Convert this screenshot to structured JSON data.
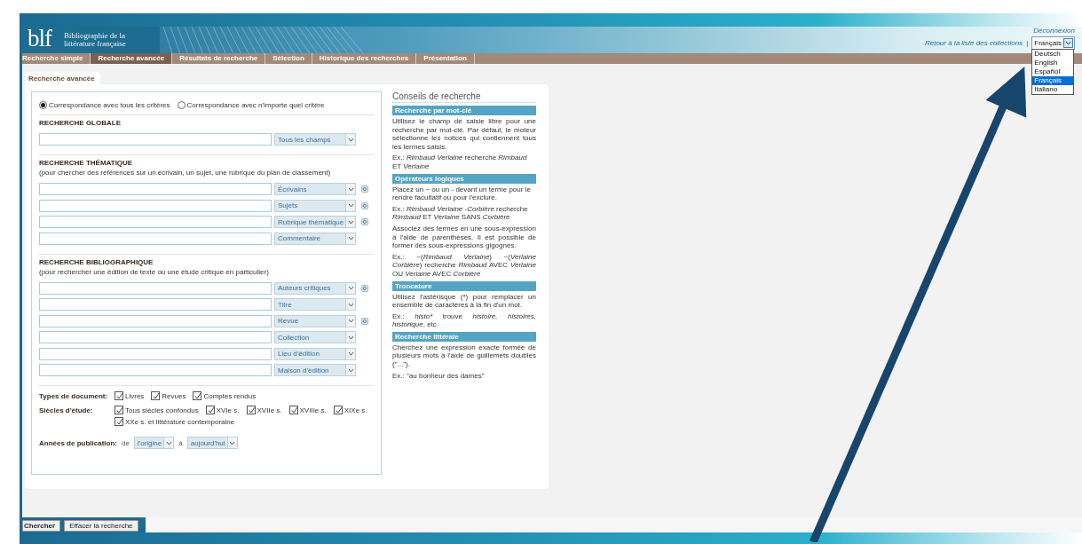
{
  "header": {
    "logo": "blf",
    "title": "Bibliographie de la littérature française"
  },
  "top_links": {
    "logout": "Déconnexion",
    "back": "Retour à la liste des collections",
    "separator": "|"
  },
  "language_select": {
    "value": "Français",
    "open": true,
    "options": [
      {
        "label": "Deutsch",
        "selected": false
      },
      {
        "label": "English",
        "selected": false
      },
      {
        "label": "Español",
        "selected": false
      },
      {
        "label": "Français",
        "selected": true
      },
      {
        "label": "Italiano",
        "selected": false
      }
    ]
  },
  "nav_tabs": [
    {
      "label": "Recherche simple",
      "selected": false
    },
    {
      "label": "Recherche avancée",
      "selected": true
    },
    {
      "label": "Résultats de recherche",
      "selected": false
    },
    {
      "label": "Sélection",
      "selected": false
    },
    {
      "label": "Historique des recherches",
      "selected": false
    },
    {
      "label": "Présentation",
      "selected": false
    }
  ],
  "page_tab": "Recherche avancée",
  "match_mode": [
    {
      "label": "Correspondance avec tous les critères",
      "selected": true
    },
    {
      "label": "Correspondance avec n'importe quel critère",
      "selected": false
    }
  ],
  "sections": [
    {
      "heading": "RECHERCHE GLOBALE",
      "rows": [
        {
          "field": "Tous les champs",
          "lookup": false
        }
      ]
    },
    {
      "heading": "RECHERCHE THÉMATIQUE",
      "note": "(pour chercher des références sur un écrivain, un sujet, une rubrique du plan de classement)",
      "rows": [
        {
          "field": "Écrivains",
          "lookup": true
        },
        {
          "field": "Sujets",
          "lookup": true
        },
        {
          "field": "Rubrique thématique",
          "lookup": true
        },
        {
          "field": "Commentaire",
          "lookup": false
        }
      ]
    },
    {
      "heading": "RECHERCHE BIBLIOGRAPHIQUE",
      "note": "(pour rechercher une édition de texte ou une étude critique en particulier)",
      "rows": [
        {
          "field": "Auteurs critiques",
          "lookup": true
        },
        {
          "field": "Titre",
          "lookup": false
        },
        {
          "field": "Revue",
          "lookup": true
        },
        {
          "field": "Collection",
          "lookup": false
        },
        {
          "field": "Lieu d'édition",
          "lookup": false
        },
        {
          "field": "Maison d'édition",
          "lookup": false
        }
      ]
    }
  ],
  "checkbox_groups": [
    {
      "label": "Types de document:",
      "items": [
        {
          "label": "Livres",
          "checked": true
        },
        {
          "label": "Revues",
          "checked": true
        },
        {
          "label": "Comptes rendus",
          "checked": true
        }
      ]
    },
    {
      "label": "Siècles d'étude:",
      "items": [
        {
          "label": "Tous siècles confondus",
          "checked": true
        },
        {
          "label": "XVIe s.",
          "checked": true
        },
        {
          "label": "XVIIe s.",
          "checked": true
        },
        {
          "label": "XVIIIe s.",
          "checked": true
        },
        {
          "label": "XIXe s.",
          "checked": true
        },
        {
          "label": "XXe s. et littérature contemporaine",
          "checked": true
        }
      ]
    }
  ],
  "years": {
    "label": "Années de publication:",
    "from_word": "de",
    "from": "l'origine",
    "to_word": "à",
    "to": "aujourd'hui"
  },
  "tips": {
    "title": "Conseils de recherche",
    "sections": [
      {
        "heading": "Recherche par mot-clé",
        "paragraphs": [
          {
            "justify": true,
            "parts": [
              {
                "text": "Utilisez le champ de saisie libre pour une recherche par mot-clé. Par défaut, le moteur sélectionne les notices qui contiennent tous les termes saisis.",
                "italic": false
              }
            ]
          },
          {
            "justify": false,
            "parts": [
              {
                "text": "Ex.: ",
                "italic": false
              },
              {
                "text": "Rimbaud Verlaine",
                "italic": true
              },
              {
                "text": " recherche ",
                "italic": false
              },
              {
                "text": "Rimbaud",
                "italic": true
              },
              {
                "text": " ET ",
                "italic": false
              },
              {
                "text": "Verlaine",
                "italic": true
              }
            ]
          }
        ]
      },
      {
        "heading": "Opérateurs logiques",
        "paragraphs": [
          {
            "justify": false,
            "parts": [
              {
                "text": "Placez un ~ ou un - devant un terme pour le rendre facultatif ou pour l'exclure.",
                "italic": false
              }
            ]
          },
          {
            "justify": false,
            "parts": [
              {
                "text": "Ex.: ",
                "italic": false
              },
              {
                "text": "Rimbaud Verlaine -Corbière",
                "italic": true
              },
              {
                "text": " recherche ",
                "italic": false
              },
              {
                "text": "Rimbaud",
                "italic": true
              },
              {
                "text": " ET ",
                "italic": false
              },
              {
                "text": "Verlaine",
                "italic": true
              },
              {
                "text": " SANS ",
                "italic": false
              },
              {
                "text": "Corbière",
                "italic": true
              }
            ]
          },
          {
            "justify": true,
            "parts": [
              {
                "text": "Associez des termes en une sous-expression à l'aide de parenthèses. Il est possible de former des sous-expressions gigognes.",
                "italic": false
              }
            ]
          },
          {
            "justify": true,
            "parts": [
              {
                "text": "Ex.: ~(",
                "italic": false
              },
              {
                "text": "Rimbaud Verlaine",
                "italic": true
              },
              {
                "text": ") ~(",
                "italic": false
              },
              {
                "text": "Verlaine Corbière",
                "italic": true
              },
              {
                "text": ") recherche ",
                "italic": false
              },
              {
                "text": "Rimbaud",
                "italic": true
              },
              {
                "text": " AVEC ",
                "italic": false
              },
              {
                "text": "Verlaine",
                "italic": true
              },
              {
                "text": " OU ",
                "italic": false
              },
              {
                "text": "Verlaine",
                "italic": true
              },
              {
                "text": " AVEC ",
                "italic": false
              },
              {
                "text": "Corbière",
                "italic": true
              }
            ]
          }
        ]
      },
      {
        "heading": "Troncature",
        "paragraphs": [
          {
            "justify": true,
            "parts": [
              {
                "text": "Utilisez l'astérisque (*) pour remplacer un ensemble de caractères à la fin d'un mot.",
                "italic": false
              }
            ]
          },
          {
            "justify": true,
            "parts": [
              {
                "text": "Ex.: ",
                "italic": false
              },
              {
                "text": "histo*",
                "italic": true
              },
              {
                "text": " trouve ",
                "italic": false
              },
              {
                "text": "histoire, histoires, historique",
                "italic": true
              },
              {
                "text": ", etc.",
                "italic": false
              }
            ]
          }
        ]
      },
      {
        "heading": "Recherche littérale",
        "paragraphs": [
          {
            "justify": true,
            "parts": [
              {
                "text": "Cherchez une expression exacte formée de plusieurs mots à l'aide de guillemets doubles (\"...\").",
                "italic": false
              }
            ]
          },
          {
            "parts": [
              {
                "text": "Ex.: \"au bonheur des dames\"",
                "italic": false
              }
            ]
          }
        ]
      }
    ]
  },
  "buttons": [
    "Chercher",
    "Effacer la recherche"
  ]
}
